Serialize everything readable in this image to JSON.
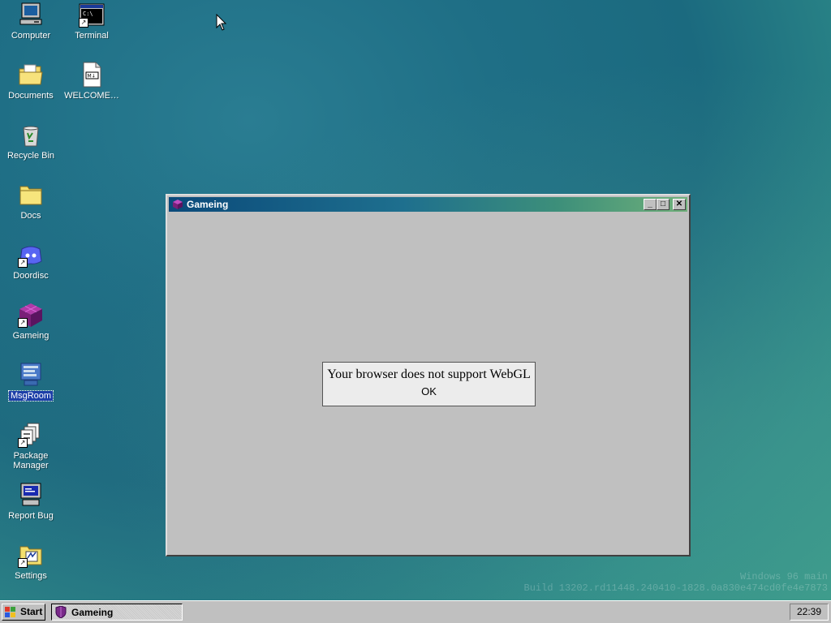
{
  "desktop": {
    "icons": [
      {
        "label": "Computer"
      },
      {
        "label": "Terminal"
      },
      {
        "label": "Documents"
      },
      {
        "label": "WELCOME…"
      },
      {
        "label": "Recycle Bin"
      },
      {
        "label": "Docs"
      },
      {
        "label": "Doordisc"
      },
      {
        "label": "Gameing"
      },
      {
        "label": "MsgRoom"
      },
      {
        "label": "Package Manager"
      },
      {
        "label": "Report Bug"
      },
      {
        "label": "Settings"
      }
    ],
    "selected_icon": "MsgRoom",
    "watermark_line1": "Windows 96 main",
    "watermark_line2": "Build 13202.rd11448.240410-1828.0a830e474cd0fe4e7873"
  },
  "window": {
    "title": "Gameing",
    "buttons": {
      "minimize": "_",
      "maximize": "□",
      "close": "✕"
    },
    "dialog": {
      "message": "Your browser does not support WebGL",
      "ok_label": "OK"
    }
  },
  "taskbar": {
    "start_label": "Start",
    "task_label": "Gameing",
    "clock": "22:39"
  },
  "colors": {
    "desktop": "#1f6f86",
    "titlebar_start": "#0b4a7a",
    "titlebar_end": "#6fb07a",
    "face": "#c0c0c0",
    "selection": "#1d3fa8"
  }
}
